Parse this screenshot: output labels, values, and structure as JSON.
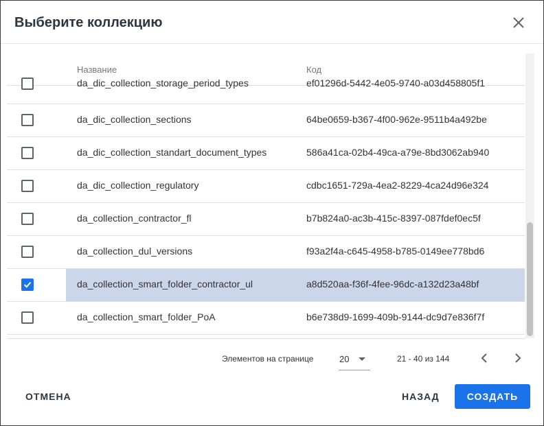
{
  "dialog": {
    "title": "Выберите коллекцию"
  },
  "table": {
    "columns": [
      "Название",
      "Код"
    ],
    "rows": [
      {
        "name": "da_dic_collection_storage_period_types",
        "code": "ef01296d-5442-4e05-9740-a03d458805f1",
        "checked": false
      },
      {
        "name": "da_dic_collection_sections",
        "code": "64be0659-b367-4f00-962e-9511b4a492be",
        "checked": false
      },
      {
        "name": "da_dic_collection_standart_document_types",
        "code": "586a41ca-02b4-49ca-a79e-8bd3062ab940",
        "checked": false
      },
      {
        "name": "da_dic_collection_regulatory",
        "code": "cdbc1651-729a-4ea2-8229-4ca24d96e324",
        "checked": false
      },
      {
        "name": "da_collection_contractor_fl",
        "code": "b7b824a0-ac3b-415c-8397-087fdef0ec5f",
        "checked": false
      },
      {
        "name": "da_collection_dul_versions",
        "code": "f93a2f4a-c645-4958-b785-0149ee778bd6",
        "checked": false
      },
      {
        "name": "da_collection_smart_folder_contractor_ul",
        "code": "a8d520aa-f36f-4fee-96dc-a132d23a48bf",
        "checked": true
      },
      {
        "name": "da_collection_smart_folder_PoA",
        "code": "b6e738d9-1699-409b-9144-dc9d7e836f7f",
        "checked": false
      }
    ]
  },
  "paginator": {
    "items_label": "Элементов на странице",
    "page_size": "20",
    "range": "21 - 40 из 144"
  },
  "footer": {
    "cancel": "ОТМЕНА",
    "back": "НАЗАД",
    "create": "СОЗДАТЬ"
  },
  "colors": {
    "accent": "#1a73e8",
    "selected_row": "#ccd6eb"
  }
}
